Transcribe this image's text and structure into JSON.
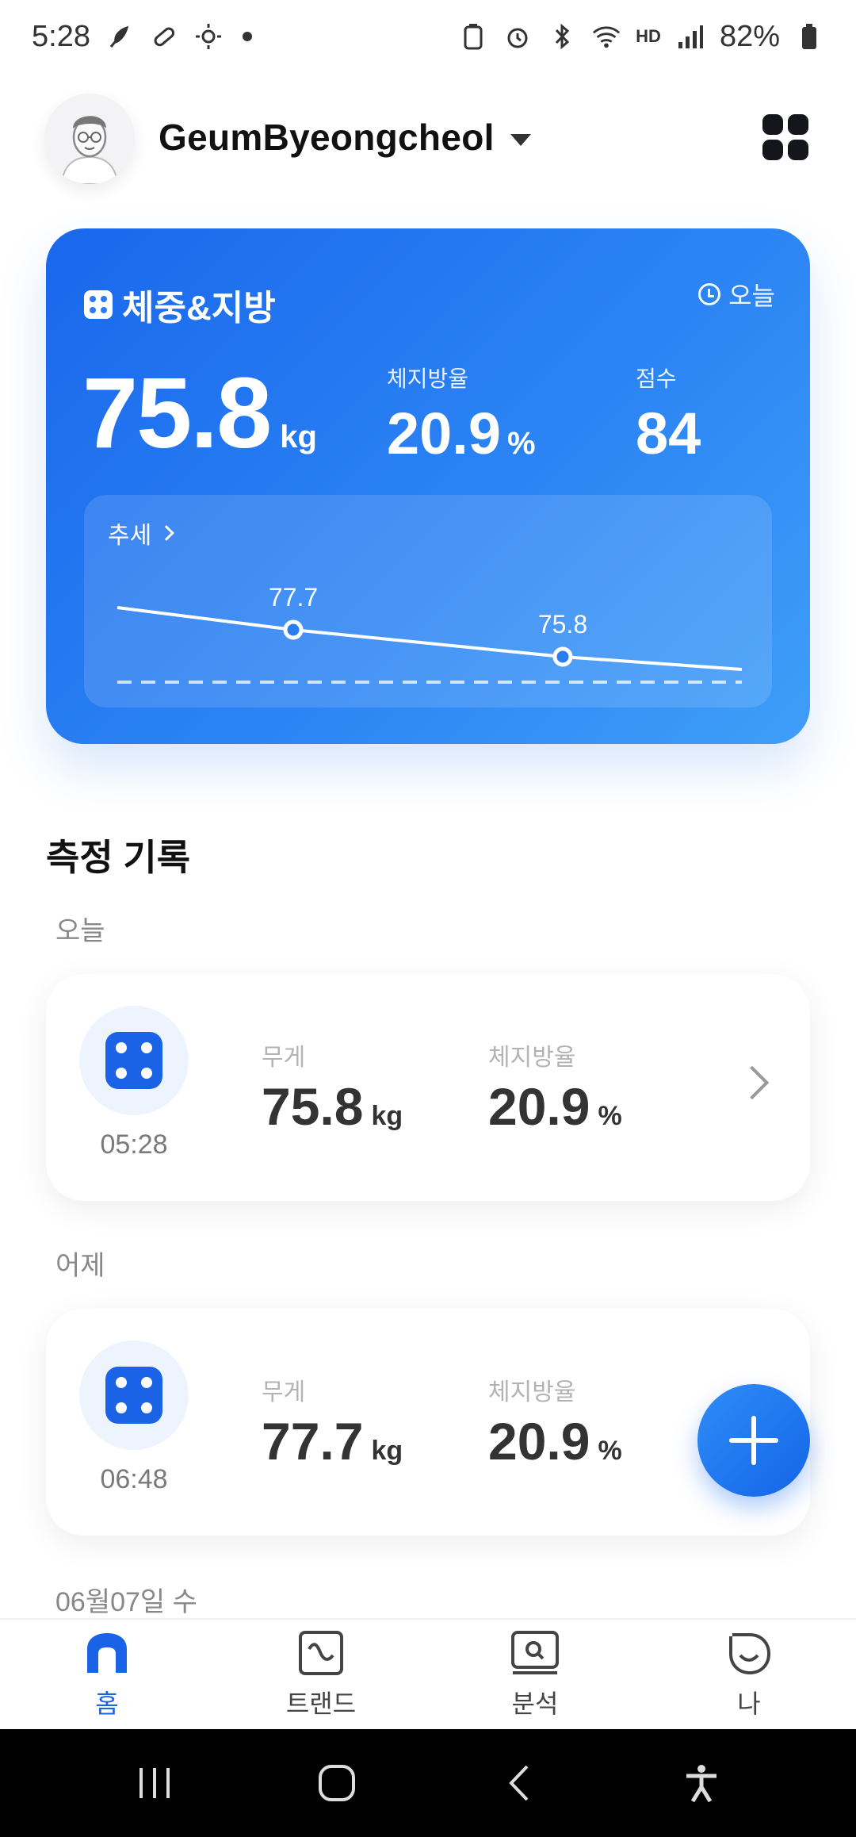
{
  "status_bar": {
    "time": "5:28",
    "battery": "82%",
    "hd_label": "HD"
  },
  "header": {
    "username": "GeumByeongcheol"
  },
  "main_card": {
    "title": "체중&지방",
    "date_tag": "오늘",
    "weight_value": "75.8",
    "weight_unit": "kg",
    "fat_label": "체지방율",
    "fat_value": "20.9",
    "fat_unit": "%",
    "score_label": "점수",
    "score_value": "84",
    "trend_label": "추세",
    "trend_points": [
      {
        "label": "77.7",
        "value": 77.7
      },
      {
        "label": "75.8",
        "value": 75.8
      }
    ]
  },
  "records": {
    "section_title": "측정 기록",
    "groups": [
      {
        "label": "오늘",
        "time": "05:28",
        "weight_label": "무게",
        "weight_value": "75.8",
        "weight_unit": "kg",
        "fat_label": "체지방율",
        "fat_value": "20.9",
        "fat_unit": "%"
      },
      {
        "label": "어제",
        "time": "06:48",
        "weight_label": "무게",
        "weight_value": "77.7",
        "weight_unit": "kg",
        "fat_label": "체지방율",
        "fat_value": "20.9",
        "fat_unit": "%"
      }
    ],
    "next_group_label": "06월07일 수"
  },
  "bottom_nav": {
    "items": [
      {
        "label": "홈",
        "active": true
      },
      {
        "label": "트랜드",
        "active": false
      },
      {
        "label": "분석",
        "active": false
      },
      {
        "label": "나",
        "active": false
      }
    ]
  },
  "colors": {
    "accent": "#1a62e6",
    "card_gradient_start": "#1967ec",
    "card_gradient_end": "#3f9ef8"
  }
}
